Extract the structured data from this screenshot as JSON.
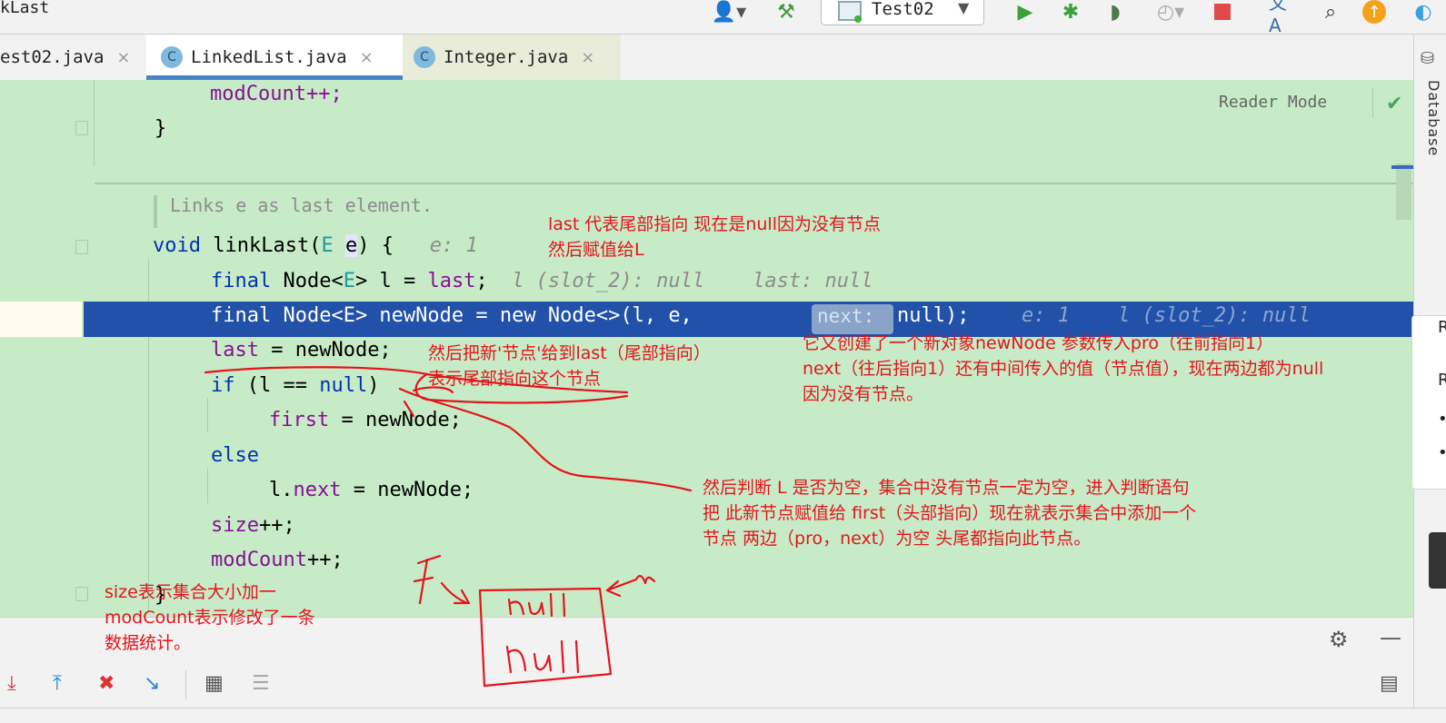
{
  "window": {
    "title": "kLast"
  },
  "toolbar": {
    "run_config": "Test02",
    "icons": [
      "user-icon",
      "build-hammer-icon",
      "run-icon",
      "debug-icon",
      "coverage-icon",
      "profile-icon",
      "stop-icon",
      "translate-icon",
      "search-icon",
      "update-icon",
      "plugin-icon"
    ]
  },
  "tabs": [
    {
      "label": "est02.java",
      "active": false
    },
    {
      "label": "LinkedList.java",
      "active": true
    },
    {
      "label": "Integer.java",
      "active": false
    }
  ],
  "tab_badge": "C",
  "tab_close": "×",
  "editor": {
    "reader_mode": "Reader Mode",
    "doc_comment": "Links e as last element.",
    "hint_next": "next:",
    "lines": {
      "l1": "modCount++;",
      "l2": "}",
      "l4_void": "void",
      "l4_name": "linkLast",
      "l4_open": "(",
      "l4_E": "E",
      "l4_e": "e",
      "l4_close": ") {",
      "l4_hint": "e: 1",
      "l5_final": "final",
      "l5_node": "Node<",
      "l5_E": "E",
      "l5_rest": "> l = ",
      "l5_last": "last",
      "l5_semi": ";",
      "l5_hint": "l (slot_2): null    last: null",
      "l6_a": "final Node<E> newNode = new Node<>(l, e,",
      "l6_b": "null);",
      "l6_hint": "e: 1    l (slot_2): null",
      "l7_last": "last",
      "l7_rest": " = newNode;",
      "l8_if": "if",
      "l8_mid": " (l == ",
      "l8_null": "null",
      "l8_end": ")",
      "l9_first": "first",
      "l9_rest": " = newNode;",
      "l10": "else",
      "l11_l": "l.",
      "l11_next": "next",
      "l11_rest": " = newNode;",
      "l12_size": "size",
      "l12_rest": "++;",
      "l13_mod": "modCount",
      "l13_rest": "++;",
      "l14": "}"
    }
  },
  "right_strip": {
    "database_label": "Database",
    "popup_r1": "R",
    "popup_r2": "R",
    "popup_b1": "•",
    "popup_b2": "•"
  },
  "annotations": {
    "a1": "last 代表尾部指向 现在是null因为没有节点\n然后赋值给L",
    "a2": "然后把新'节点'给到last（尾部指向）\n表示尾部指向这个节点",
    "a3": "它又创建了一个新对象newNode 参数传入pro（往前指向1）\nnext（往后指向1）还有中间传入的值（节点值），现在两边都为null\n因为没有节点。",
    "a4": "然后判断 L 是否为空，集合中没有节点一定为空，进入判断语句\n把 此新节点赋值给 first（头部指向）现在就表示集合中添加一个\n节点 两边（pro，next）为空 头尾都指向此节点。",
    "a5": "size表示集合大小加一\nmodCount表示修改了一条\n数据统计。"
  },
  "colors": {
    "editor_bg": "#c7ebc7",
    "exec_line": "#2151a8",
    "annotation": "#e5141b",
    "keyword": "#0033b3",
    "field": "#871094"
  }
}
